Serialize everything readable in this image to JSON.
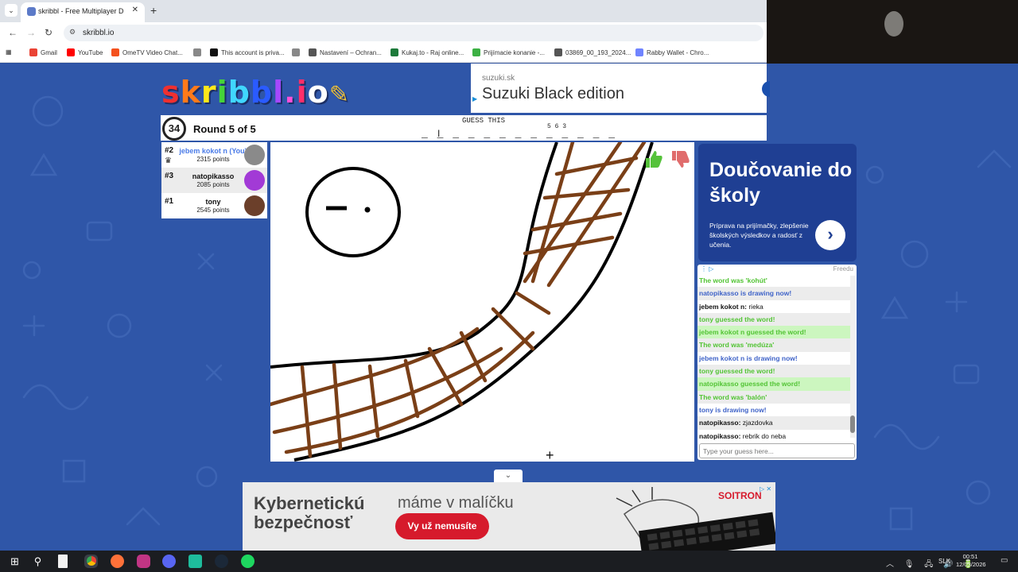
{
  "browser": {
    "tab_title": "skribbl - Free Multiplayer Draw",
    "url": "skribbl.io",
    "bookmarks": [
      {
        "label": "Gmail",
        "color": "#ea4335"
      },
      {
        "label": "YouTube",
        "color": "#ff0000"
      },
      {
        "label": "OmeTV Video Chat...",
        "color": "#f4511e"
      },
      {
        "label": "",
        "color": "#888888"
      },
      {
        "label": "This account is priva...",
        "color": "#111111"
      },
      {
        "label": "",
        "color": "#888888"
      },
      {
        "label": "Nastavení – Ochran...",
        "color": "#555555"
      },
      {
        "label": "Kukaj.to - Raj online...",
        "color": "#1d7a3a"
      },
      {
        "label": "Prijímacie konanie -...",
        "color": "#3cb043"
      },
      {
        "label": "03869_00_193_2024...",
        "color": "#555555"
      },
      {
        "label": "Rabby Wallet - Chro...",
        "color": "#7084ff"
      }
    ]
  },
  "logo": {
    "text": "skribbl.io"
  },
  "ad_top": {
    "domain": "suzuki.sk",
    "title": "Suzuki Black edition"
  },
  "game": {
    "timer": "34",
    "round": "Round 5 of 5",
    "guess_label": "GUESS THIS",
    "word_hint": "_ _ _ _  _ _ _ _ _ _  _ _ _",
    "word_lengths": "5 6 3"
  },
  "players": [
    {
      "rank": "#2",
      "name": "jebem kokot n (You)",
      "points": "2315 points",
      "is_you": true,
      "avatar_color": "#8a8a8a",
      "crown": true
    },
    {
      "rank": "#3",
      "name": "natopikasso",
      "points": "2085 points",
      "is_you": false,
      "avatar_color": "#a23ad6",
      "crown": false
    },
    {
      "rank": "#1",
      "name": "tony",
      "points": "2545 points",
      "is_you": false,
      "avatar_color": "#6b3f2a",
      "crown": false
    }
  ],
  "ad_right": {
    "title": "Doučovanie do školy",
    "body": "Príprava na prijímačky, zlepšenie školských výsledkov a radosť z učenia.",
    "info": "Freedu"
  },
  "chat": {
    "messages": [
      {
        "style": "green",
        "author": "",
        "text": "The word was 'kohút'"
      },
      {
        "style": "blue",
        "author": "",
        "text": "natopikasso is drawing now!"
      },
      {
        "style": "user",
        "author": "jebem kokot n: ",
        "text": "rieka"
      },
      {
        "style": "green",
        "author": "",
        "text": "tony guessed the word!"
      },
      {
        "style": "gbg",
        "author": "",
        "text": "jebem kokot n guessed the word!"
      },
      {
        "style": "green",
        "author": "",
        "text": "The word was 'medúza'"
      },
      {
        "style": "blue",
        "author": "",
        "text": "jebem kokot n is drawing now!"
      },
      {
        "style": "green",
        "author": "",
        "text": "tony guessed the word!"
      },
      {
        "style": "gbg",
        "author": "",
        "text": "natopikasso guessed the word!"
      },
      {
        "style": "green",
        "author": "",
        "text": "The word was 'balón'"
      },
      {
        "style": "blue",
        "author": "",
        "text": "tony is drawing now!"
      },
      {
        "style": "user",
        "author": "natopikasso: ",
        "text": "zjazdovka"
      },
      {
        "style": "user",
        "author": "natopikasso: ",
        "text": "rebrik do neba"
      }
    ],
    "input_placeholder": "Type your guess here..."
  },
  "ad_bottom": {
    "title": "Kybernetickú bezpečnosť",
    "subtitle": "máme v malíčku",
    "button": "Vy už nemusíte",
    "brand": "SOITRON"
  },
  "taskbar": {
    "language": "SLK",
    "time": "00:51",
    "date": "12/03/2026"
  }
}
